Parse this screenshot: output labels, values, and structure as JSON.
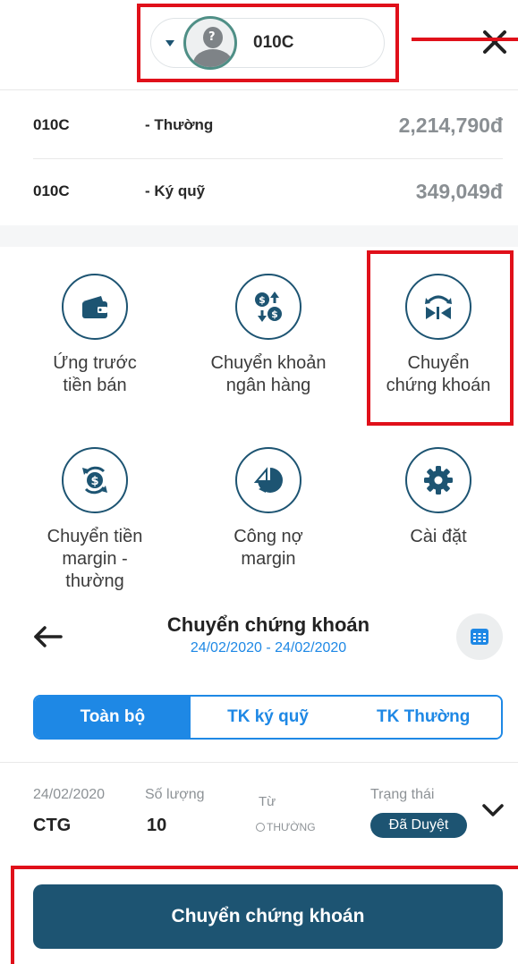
{
  "header": {
    "account_code": "010C",
    "avatar_glyph": "?"
  },
  "balances": [
    {
      "code": "010C",
      "type": "- Thường",
      "amount": "2,214,790đ"
    },
    {
      "code": "010C",
      "type": "- Ký quỹ",
      "amount": "349,049đ"
    }
  ],
  "actions": [
    {
      "label": "Ứng trước\ntiền bán",
      "icon": "wallet-icon"
    },
    {
      "label": "Chuyển khoản\nngân hàng",
      "icon": "money-exchange-icon"
    },
    {
      "label": "Chuyển\nchứng khoán",
      "icon": "stock-transfer-icon"
    },
    {
      "label": "Chuyển tiền\nmargin -\nthường",
      "icon": "money-refresh-icon"
    },
    {
      "label": "Công nợ\nmargin",
      "icon": "pie-chart-icon"
    },
    {
      "label": "Cài đặt",
      "icon": "gear-icon"
    }
  ],
  "transfer": {
    "title": "Chuyển chứng khoán",
    "date_range": "24/02/2020 - 24/02/2020"
  },
  "tabs": [
    {
      "label": "Toàn bộ",
      "active": true
    },
    {
      "label": "TK ký quỹ",
      "active": false
    },
    {
      "label": "TK Thường",
      "active": false
    }
  ],
  "record": {
    "date": "24/02/2020",
    "symbol": "CTG",
    "quantity_label": "Số lượng",
    "quantity": "10",
    "from_label": "Từ",
    "from_value": "THƯỜNG",
    "status_label": "Trạng thái",
    "status": "Đã Duyệt"
  },
  "primary_button": {
    "label": "Chuyển chứng khoán"
  },
  "colors": {
    "primary": "#1d5472",
    "accent": "#1e88e5",
    "annotation": "#e0101a"
  }
}
